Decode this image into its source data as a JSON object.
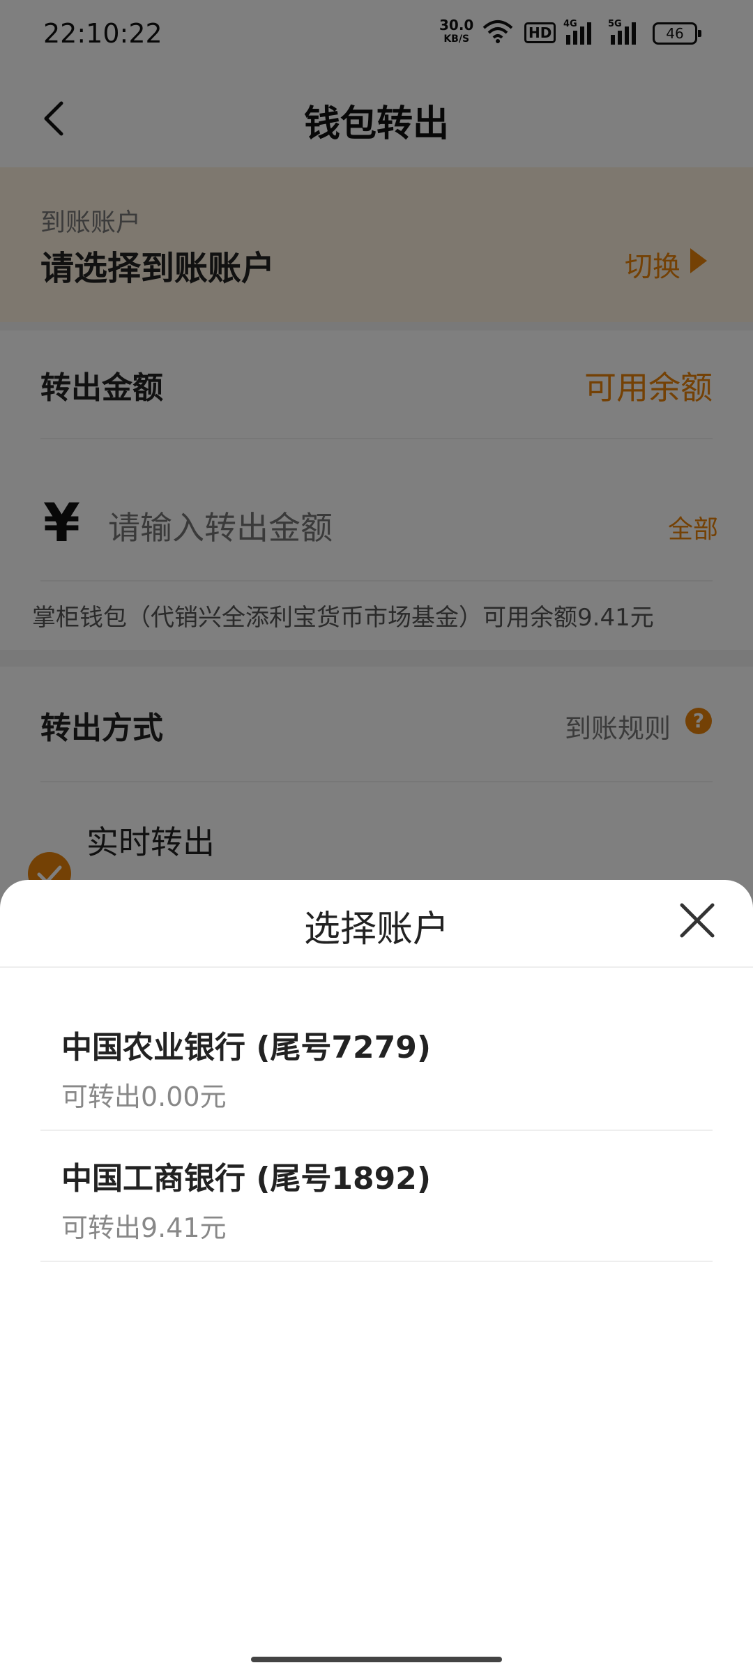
{
  "status_bar": {
    "time": "22:10:22",
    "net_speed": "30.0",
    "net_speed_unit": "KB/S",
    "hd_label": "HD",
    "sig1_label": "4G",
    "sig2_label": "5G",
    "battery": "46"
  },
  "header": {
    "title": "钱包转出"
  },
  "account": {
    "label": "到账账户",
    "value": "请选择到账账户",
    "switch_label": "切换"
  },
  "amount": {
    "title": "转出金额",
    "available_link": "可用余额",
    "currency_symbol": "¥",
    "input_placeholder": "请输入转出金额",
    "all_label": "全部",
    "balance_note": "掌柜钱包（代销兴全添利宝货币市场基金）可用余额9.41元"
  },
  "method": {
    "title": "转出方式",
    "rules_link": "到账规则",
    "help_glyph": "?",
    "realtime_label": "实时转出"
  },
  "sheet": {
    "title": "选择账户",
    "accounts": [
      {
        "name": "中国农业银行 (尾号7279)",
        "available": "可转出0.00元"
      },
      {
        "name": "中国工商银行 (尾号1892)",
        "available": "可转出9.41元"
      }
    ]
  },
  "colors": {
    "accent": "#e8830a",
    "account_bg": "#fdf0de"
  }
}
